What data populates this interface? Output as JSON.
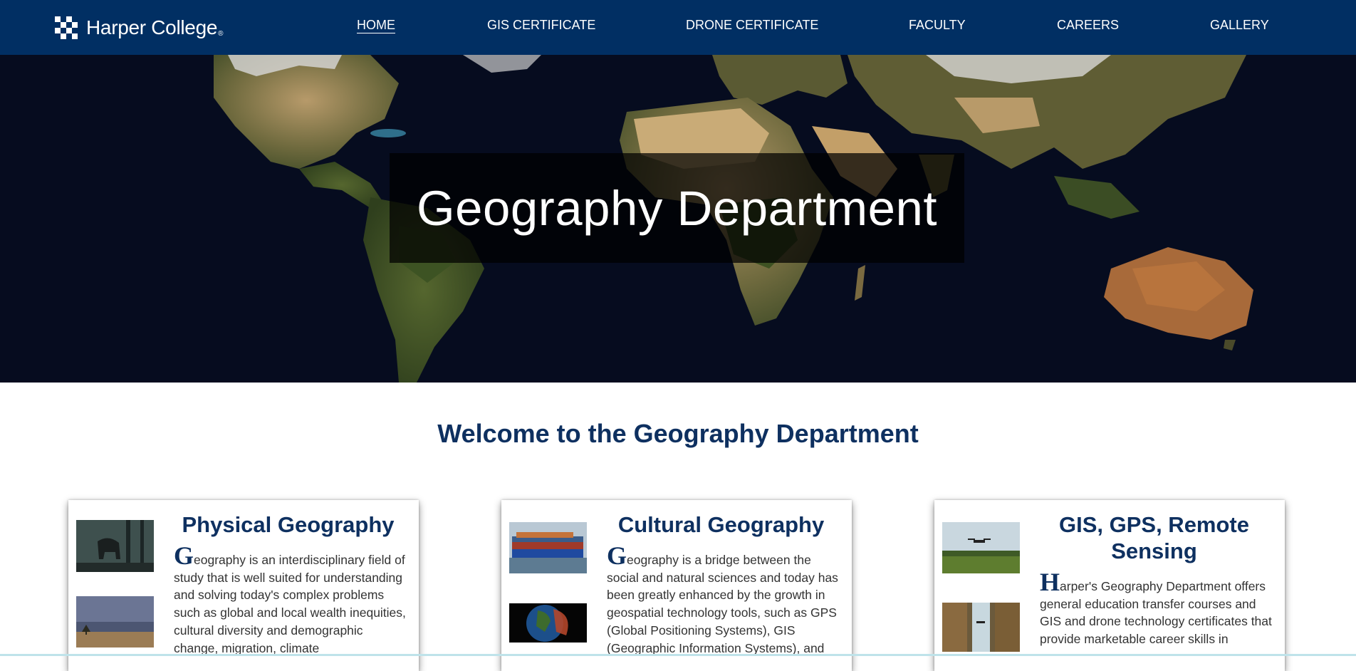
{
  "brand": {
    "name": "Harper College",
    "reg": "®"
  },
  "nav": {
    "items": [
      {
        "label": "HOME",
        "active": true
      },
      {
        "label": "GIS CERTIFICATE",
        "active": false
      },
      {
        "label": "DRONE CERTIFICATE",
        "active": false
      },
      {
        "label": "FACULTY",
        "active": false
      },
      {
        "label": "CAREERS",
        "active": false
      },
      {
        "label": "GALLERY",
        "active": false
      }
    ]
  },
  "hero": {
    "title": "Geography Department",
    "image": "world-map-satellite"
  },
  "welcome": {
    "heading": "Welcome to the Geography Department"
  },
  "cards": [
    {
      "title": "Physical Geography",
      "dropcap": "G",
      "body": "eography is an interdisciplinary field of study that is well suited for understanding and solving today's complex problems such as global and local wealth inequities, cultural diversity and demographic change, migration, climate",
      "thumbs": [
        "elephant-in-forest",
        "storm-over-savanna"
      ]
    },
    {
      "title": "Cultural Geography",
      "dropcap": "G",
      "body": "eography is a bridge between the social and natural sciences and today has been greatly enhanced by the growth in geospatial technology tools, such as GPS (Global Positioning Systems), GIS (Geographic Information Systems), and",
      "thumbs": [
        "container-ship",
        "earth-globe"
      ]
    },
    {
      "title": "GIS, GPS, Remote Sensing",
      "dropcap": "H",
      "body": "arper's Geography Department offers general education transfer courses and GIS and drone technology certificates that provide marketable career skills in",
      "thumbs": [
        "drone-over-field",
        "drone-waterfall"
      ]
    }
  ],
  "colors": {
    "navy": "#012f63",
    "heading": "#0e3060",
    "text": "#333333"
  }
}
